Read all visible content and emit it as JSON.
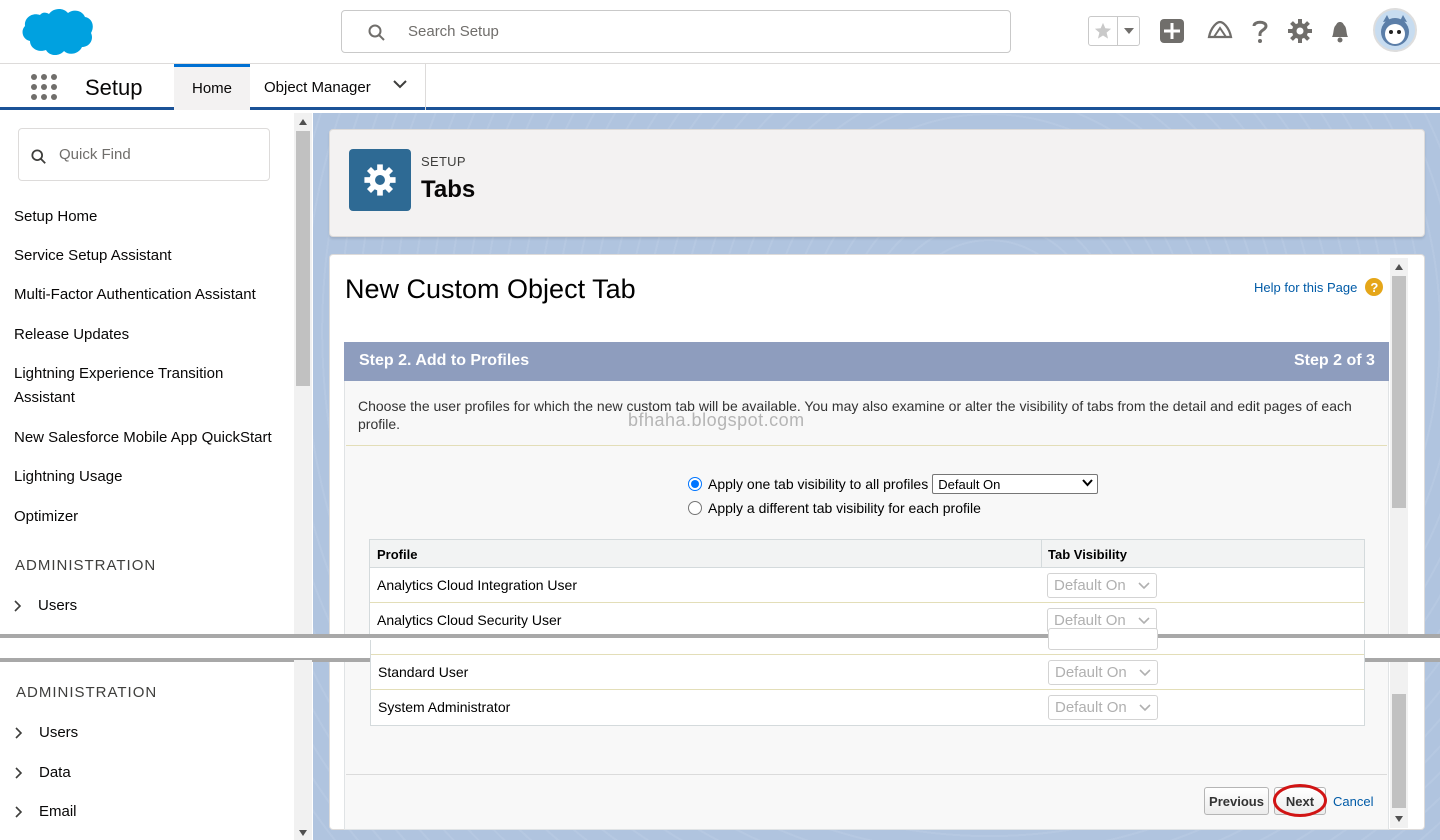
{
  "header": {
    "search_placeholder": "Search Setup",
    "icons": [
      "salesforce-cloud-logo",
      "star-icon",
      "chevron-down-icon",
      "add-icon",
      "trailhead-icon",
      "help-icon",
      "gear-icon",
      "bell-icon",
      "avatar"
    ]
  },
  "app_nav": {
    "app_name": "Setup",
    "tabs": [
      {
        "label": "Home",
        "active": true
      },
      {
        "label": "Object Manager",
        "active": false
      }
    ]
  },
  "sidebar": {
    "quick_find_placeholder": "Quick Find",
    "links": [
      "Setup Home",
      "Service Setup Assistant",
      "Multi-Factor Authentication Assistant",
      "Release Updates",
      "Lightning Experience Transition Assistant",
      "New Salesforce Mobile App QuickStart",
      "Lightning Usage",
      "Optimizer"
    ],
    "section_heading": "ADMINISTRATION",
    "upper_tree": [
      "Users"
    ],
    "lower_section_heading": "ADMINISTRATION",
    "lower_tree": [
      "Users",
      "Data",
      "Email"
    ]
  },
  "page_header": {
    "breadcrumb": "SETUP",
    "title": "Tabs"
  },
  "form": {
    "title": "New Custom Object Tab",
    "help_link": "Help for this Page",
    "step_title": "Step 2. Add to Profiles",
    "step_count": "Step 2 of 3",
    "description": "Choose the user profiles for which the new custom tab will be available. You may also examine or alter the visibility of tabs from the detail and edit pages of each profile.",
    "watermark": "bfhaha.blogspot.com",
    "radio_all_label": "Apply one tab visibility to all profiles",
    "radio_all_selected": true,
    "radio_each_label": "Apply a different tab visibility for each profile",
    "visibility_value": "Default On",
    "table": {
      "columns": [
        "Profile",
        "Tab Visibility"
      ],
      "rows_upper": [
        {
          "profile": "Analytics Cloud Integration User",
          "visibility": "Default On"
        },
        {
          "profile": "Analytics Cloud Security User",
          "visibility": "Default On"
        }
      ],
      "rows_lower": [
        {
          "profile": "Standard User",
          "visibility": "Default On"
        },
        {
          "profile": "System Administrator",
          "visibility": "Default On"
        }
      ]
    },
    "buttons": {
      "previous": "Previous",
      "next": "Next",
      "cancel": "Cancel"
    }
  },
  "colors": {
    "accent_blue": "#0070d2",
    "step_bar": "#8e9dbe",
    "page_icon": "#2e6a94",
    "highlight_circle": "#d11414"
  }
}
